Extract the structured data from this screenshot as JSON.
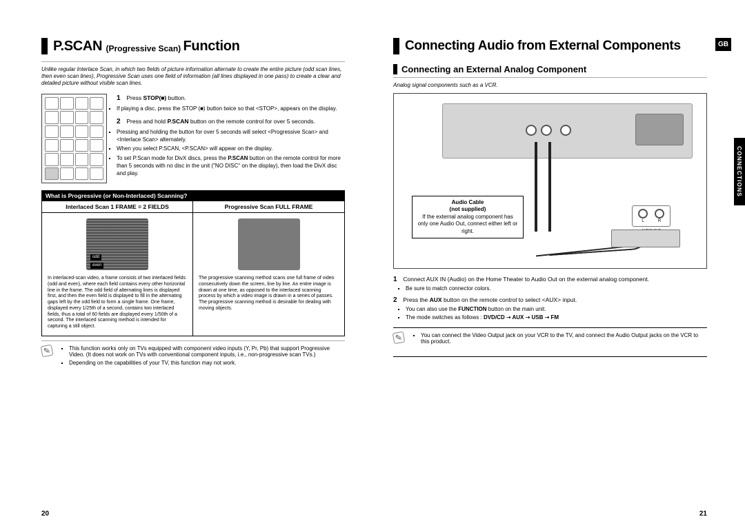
{
  "leftPage": {
    "heading": "P.SCAN ",
    "heading_sub": "(Progressive Scan) ",
    "heading_tail": "Function",
    "intro": "Unlike regular Interlace Scan, in which two fields of picture information alternate to create the entire picture (odd scan lines, then even scan lines), Progressive Scan uses one field of information (all lines displayed in one pass) to create a clear and detailed picture without visible scan lines.",
    "step1_pre": "Press ",
    "step1_bold": "STOP(■)",
    "step1_post": " button.",
    "step1_bullet": "If playing a disc, press the STOP (■) button twice so that <STOP>, appears on the display.",
    "step2_pre": "Press and hold ",
    "step2_bold": "P.SCAN",
    "step2_post": " button on the remote control for over 5 seconds.",
    "step2_b1": "Pressing and holding the button for over 5 seconds will select <Progressive Scan> and <Interlace Scan> alternately.",
    "step2_b2": "When you select P.SCAN, <P.SCAN> will appear on the display.",
    "step2_b3_pre": "To set P.Scan mode for DivX discs, press the ",
    "step2_b3_bold": "P.SCAN",
    "step2_b3_post": " button on the remote control for more than 5 seconds with no disc in the unit (\"NO DISC\" on the display), then load the DivX disc and play.",
    "strip": "What is Progressive (or Non-Interlaced) Scanning?",
    "th_left": "Interlaced Scan 1 FRAME = 2 FIELDS",
    "th_right": "Progressive Scan FULL FRAME",
    "even": "even",
    "odd": "odd",
    "td_left": "In interlaced-scan video, a frame consists of two interlaced fields (odd and even), where each field contains every other horizontal line in the frame. The odd field of alternating lines is displayed first, and then the even field is displayed to fill in the alternating gaps left by the odd field to form a single frame. One frame, displayed every 1/25th of a second, contains two interlaced fields, thus a total of 60 fields are displayed every 1/50th of a second. The interlaced scanning method is intended for capturing a still object.",
    "td_right": "The progressive scanning method scans one full frame of video consecutively down the screen, line by line. An entire image is drawn at one time, as opposed to the interlaced scanning process by which a video image is drawn in a series of passes. The progressive scanning method is desirable for dealing with moving objects.",
    "note_b1": "This function works only on TVs equipped with component video inputs (Y, Pr, Pb) that support Progressive Video. (It does not work on TVs with conventional component inputs, i.e., non-progressive scan TVs.)",
    "note_b2": "Depending on the capabilities of your TV, this function may not work.",
    "pageNum": "20"
  },
  "rightPage": {
    "heading": "Connecting Audio from External Components",
    "gb": "GB",
    "tab": "CONNECTIONS",
    "sub_heading": "Connecting an External Analog Component",
    "sub_intro": "Analog signal components such as a VCR.",
    "label_bold1": "Audio Cable",
    "label_bold2": "(not supplied)",
    "label_body": "If the external analog component has only one Audio Out, connect either left or right.",
    "port_l": "L",
    "port_r": "R",
    "port_caption": "AUDIO OUT",
    "step1": "Connect AUX IN (Audio) on the Home Theater to Audio Out on the external analog component.",
    "step1_b1": "Be sure to match connector colors.",
    "step2_pre": "Press the ",
    "step2_bold": "AUX",
    "step2_post": " button on the remote control to select <AUX> input.",
    "step2_b1_pre": "You can also use the ",
    "step2_b1_bold": "FUNCTION",
    "step2_b1_post": " button on the main unit.",
    "step2_b2_pre": "The mode switches as follows : ",
    "step2_b2_bold": "DVD/CD ➝ AUX ➝ USB ➝ FM",
    "note_b1": "You can connect the Video Output jack on your VCR to the TV, and connect the Audio Output jacks on the VCR to this product.",
    "pageNum": "21"
  }
}
